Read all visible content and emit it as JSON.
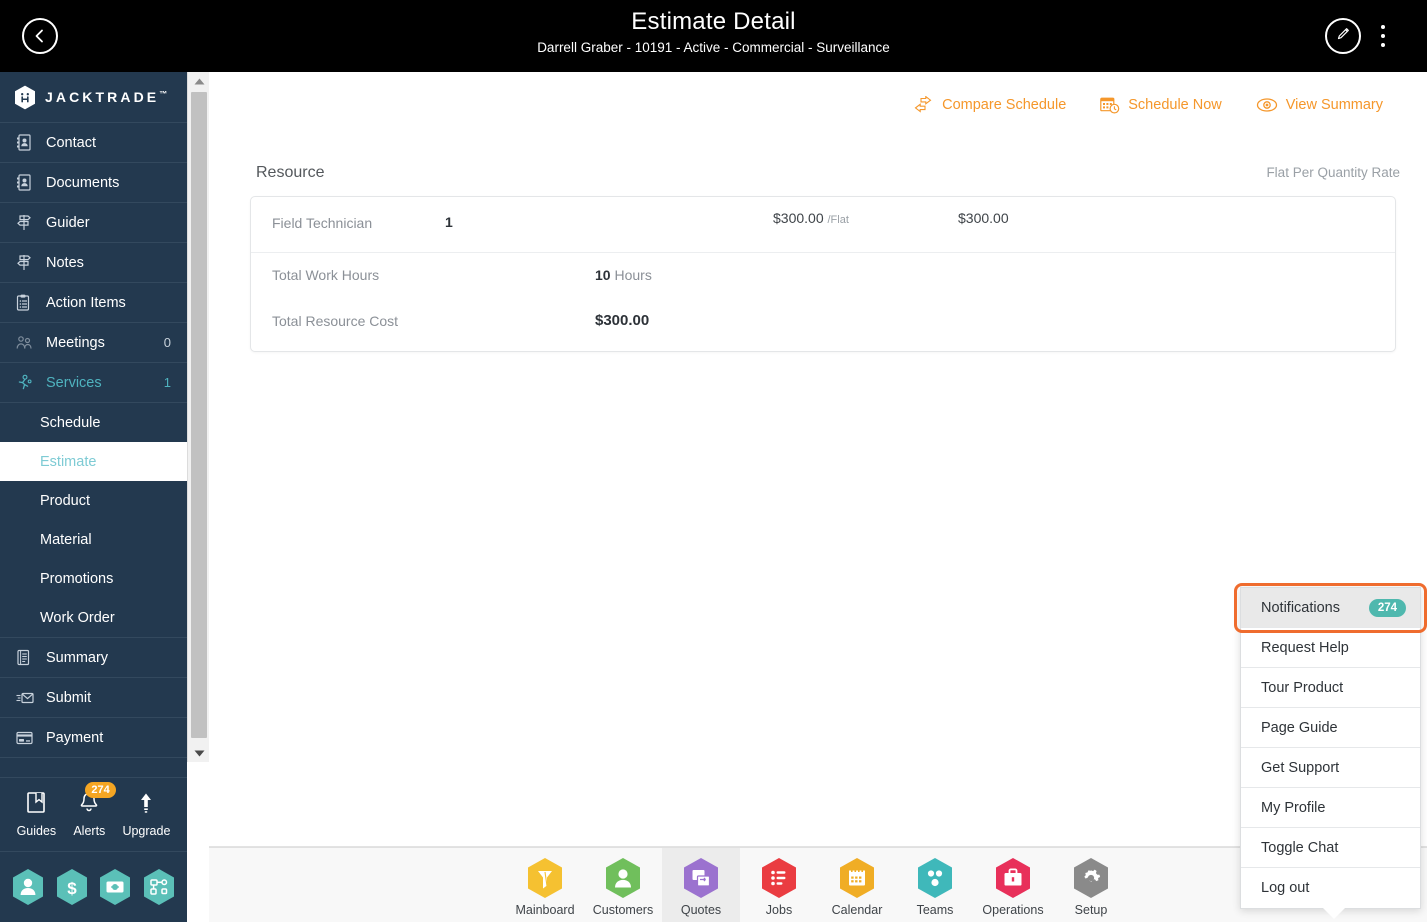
{
  "header": {
    "title": "Estimate Detail",
    "subtitle": "Darrell Graber - 10191 - Active - Commercial - Surveillance",
    "back_icon": "chevron-left-icon",
    "edit_icon": "pencil-icon",
    "kebab_icon": "more-vertical-icon"
  },
  "sidebar": {
    "brand": "JACKTRADE",
    "brand_tm": "™",
    "items": [
      {
        "label": "Contact",
        "icon": "contact-book-icon",
        "count": ""
      },
      {
        "label": "Documents",
        "icon": "documents-icon",
        "count": ""
      },
      {
        "label": "Guider",
        "icon": "signpost-icon",
        "count": ""
      },
      {
        "label": "Notes",
        "icon": "signpost-icon",
        "count": ""
      },
      {
        "label": "Action Items",
        "icon": "clipboard-icon",
        "count": ""
      },
      {
        "label": "Meetings",
        "icon": "meetings-icon",
        "count": "0"
      },
      {
        "label": "Services",
        "icon": "services-icon",
        "count": "1"
      }
    ],
    "sub_items": [
      {
        "label": "Schedule",
        "active": false
      },
      {
        "label": "Estimate",
        "active": true
      },
      {
        "label": "Product",
        "active": false
      },
      {
        "label": "Material",
        "active": false
      },
      {
        "label": "Promotions",
        "active": false
      },
      {
        "label": "Work Order",
        "active": false
      }
    ],
    "items_after": [
      {
        "label": "Summary",
        "icon": "summary-icon",
        "count": ""
      },
      {
        "label": "Submit",
        "icon": "submit-mail-icon",
        "count": ""
      },
      {
        "label": "Payment",
        "icon": "payment-card-icon",
        "count": ""
      }
    ],
    "tools": [
      {
        "label": "Guides",
        "icon": "book-icon",
        "badge": ""
      },
      {
        "label": "Alerts",
        "icon": "bell-icon",
        "badge": "274"
      },
      {
        "label": "Upgrade",
        "icon": "upload-arrow-icon",
        "badge": ""
      }
    ],
    "hex_buttons": [
      {
        "icon": "user-hex-icon"
      },
      {
        "icon": "dollar-hex-icon"
      },
      {
        "icon": "money-hex-icon"
      },
      {
        "icon": "workflow-hex-icon"
      }
    ]
  },
  "actions": [
    {
      "label": "Compare Schedule",
      "icon": "compare-arrows-icon"
    },
    {
      "label": "Schedule Now",
      "icon": "calendar-clock-icon"
    },
    {
      "label": "View Summary",
      "icon": "eye-icon"
    }
  ],
  "resource": {
    "section_title": "Resource",
    "rate_mode": "Flat Per Quantity Rate",
    "line": {
      "name": "Field Technician",
      "quantity": "1",
      "rate": "$300.00",
      "rate_unit": "/Flat",
      "amount": "$300.00"
    },
    "total_hours_label": "Total Work Hours",
    "total_hours_value": "10",
    "total_hours_unit": "Hours",
    "total_cost_label": "Total Resource Cost",
    "total_cost_value": "$300.00"
  },
  "dropdown": {
    "items": [
      {
        "label": "Notifications",
        "badge": "274",
        "highlighted": true
      },
      {
        "label": "Request Help",
        "badge": "",
        "highlighted": false
      },
      {
        "label": "Tour Product",
        "badge": "",
        "highlighted": false
      },
      {
        "label": "Page Guide",
        "badge": "",
        "highlighted": false
      },
      {
        "label": "Get Support",
        "badge": "",
        "highlighted": false
      },
      {
        "label": "My Profile",
        "badge": "",
        "highlighted": false
      },
      {
        "label": "Toggle Chat",
        "badge": "",
        "highlighted": false
      },
      {
        "label": "Log out",
        "badge": "",
        "highlighted": false
      }
    ]
  },
  "bottom_nav": [
    {
      "label": "Mainboard",
      "icon": "mainboard-hex-icon",
      "color": "#f5c131",
      "active": false
    },
    {
      "label": "Customers",
      "icon": "customers-hex-icon",
      "color": "#70bf5c",
      "active": false
    },
    {
      "label": "Quotes",
      "icon": "quotes-hex-icon",
      "color": "#9b72cf",
      "active": true
    },
    {
      "label": "Jobs",
      "icon": "jobs-hex-icon",
      "color": "#ea3c41",
      "active": false
    },
    {
      "label": "Calendar",
      "icon": "calendar-hex-icon",
      "color": "#f0ad25",
      "active": false
    },
    {
      "label": "Teams",
      "icon": "teams-hex-icon",
      "color": "#3fb8ba",
      "active": false
    },
    {
      "label": "Operations",
      "icon": "operations-hex-icon",
      "color": "#e8305a",
      "active": false
    },
    {
      "label": "Setup",
      "icon": "setup-hex-icon",
      "color": "#8a8a8a",
      "active": false
    }
  ],
  "colors": {
    "sidebar_bg": "#23394f",
    "accent_orange": "#f5972b",
    "teal": "#4fb8ae",
    "highlight_ring": "#ef6c2e",
    "badge_orange": "#f5a623"
  }
}
